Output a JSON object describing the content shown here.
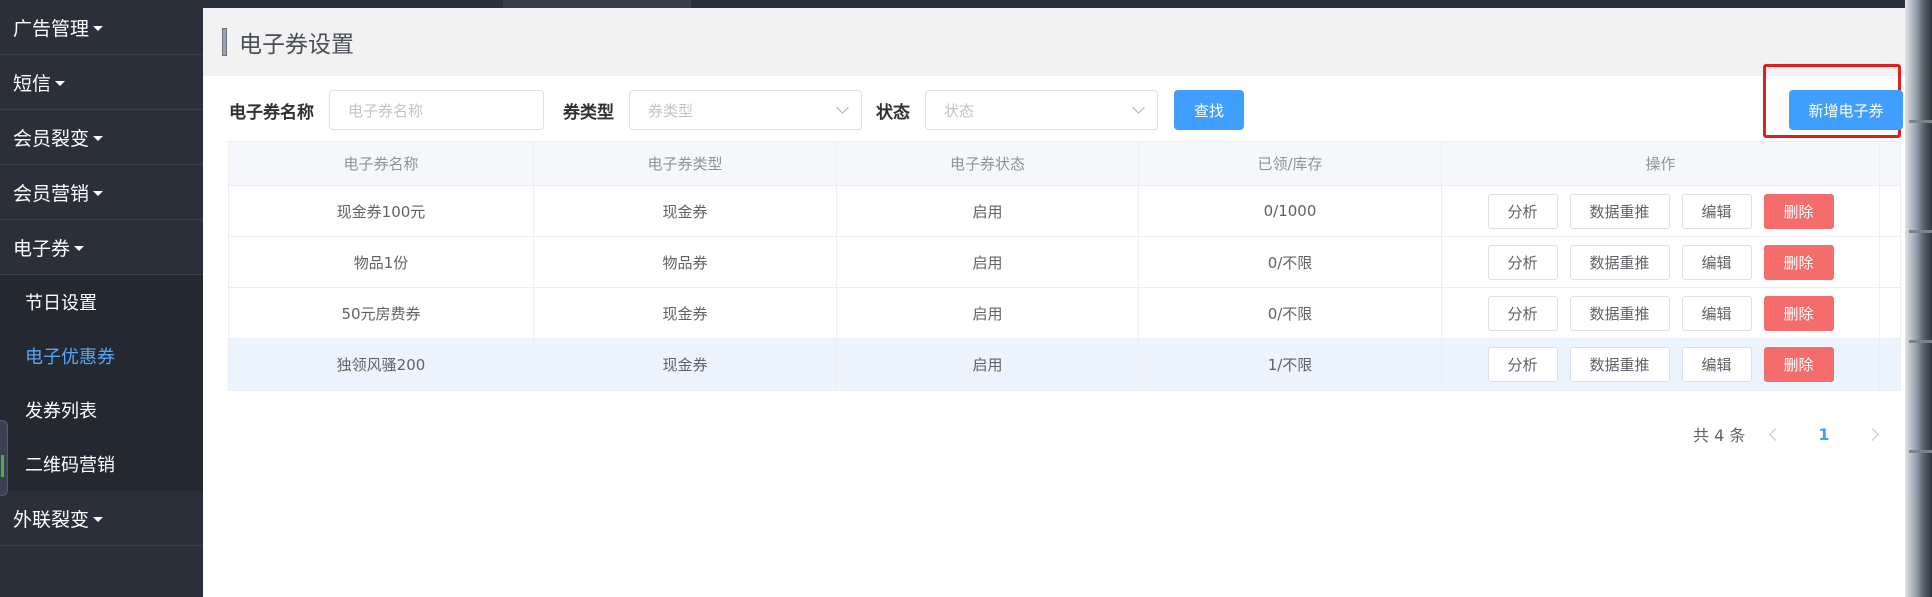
{
  "sidebar": {
    "groups_top": [
      {
        "label": "广告管理"
      },
      {
        "label": "短信"
      },
      {
        "label": "会员裂变"
      },
      {
        "label": "会员营销"
      },
      {
        "label": "电子券"
      }
    ],
    "sub_items": [
      {
        "label": "节日设置",
        "active": false
      },
      {
        "label": "电子优惠券",
        "active": true
      },
      {
        "label": "发券列表",
        "active": false
      },
      {
        "label": "二维码营销",
        "active": false
      }
    ],
    "groups_bottom": [
      {
        "label": "外联裂变"
      }
    ]
  },
  "page": {
    "title": "电子券设置"
  },
  "filters": {
    "name_label": "电子券名称",
    "name_placeholder": "电子券名称",
    "type_label": "券类型",
    "type_placeholder": "券类型",
    "status_label": "状态",
    "status_placeholder": "状态",
    "search_label": "查找",
    "add_label": "新增电子券"
  },
  "table": {
    "headers": [
      "电子券名称",
      "电子券类型",
      "电子券状态",
      "已领/库存",
      "操作"
    ],
    "rows": [
      {
        "name": "现金券100元",
        "type": "现金券",
        "status": "启用",
        "stock": "0/1000"
      },
      {
        "name": "物品1份",
        "type": "物品券",
        "status": "启用",
        "stock": "0/不限"
      },
      {
        "name": "50元房费券",
        "type": "现金券",
        "status": "启用",
        "stock": "0/不限"
      },
      {
        "name": "独领风骚200",
        "type": "现金券",
        "status": "启用",
        "stock": "1/不限"
      }
    ],
    "actions": {
      "analyze": "分析",
      "repush": "数据重推",
      "edit": "编辑",
      "delete": "删除"
    }
  },
  "pagination": {
    "total_text": "共 4 条",
    "current_page": "1"
  },
  "colors": {
    "primary": "#409eff",
    "danger": "#f56c6c",
    "sidebar_bg": "#2b2f3a",
    "active_sub": "#5aa4f6",
    "highlight_border": "#e02020"
  }
}
